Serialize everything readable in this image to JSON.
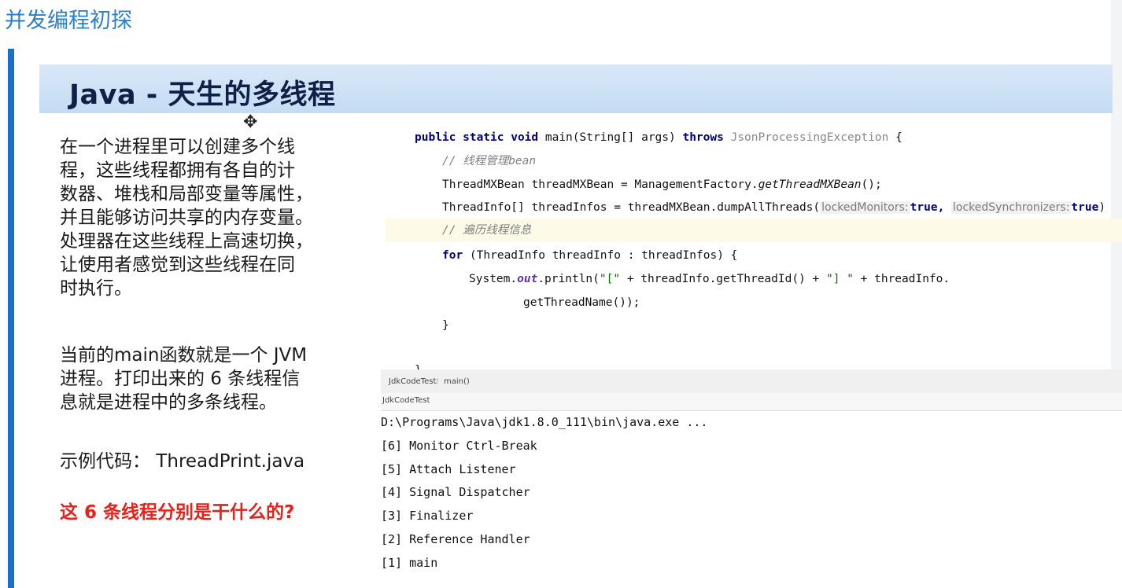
{
  "page": {
    "title": "并发编程初探"
  },
  "slide": {
    "banner_title": "Java - 天生的多线程",
    "paragraph1": "在一个进程里可以创建多个线\n程，这些线程都拥有各自的计\n数器、堆栈和局部变量等属性，\n并且能够访问共享的内存变量。\n处理器在这些线程上高速切换，\n让使用者感觉到这些线程在同\n时执行。",
    "paragraph2": "当前的main函数就是一个 JVM\n进程。打印出来的 6 条线程信\n息就是进程中的多条线程。",
    "paragraph3": "示例代码：  ThreadPrint.java",
    "question": "这 6 条线程分别是干什么的?",
    "question_color": "#e8211b",
    "accent_color": "#1a6fc7"
  },
  "code": {
    "line1": {
      "kw": "public static void",
      "sig": " main(String[] args) ",
      "throws": "throws",
      "exc": " JsonProcessingException",
      "tail": " {"
    },
    "line2": "// 线程管理bean",
    "line3": {
      "a": "ThreadMXBean threadMXBean = ManagementFactory.",
      "b": "getThreadMXBean",
      "c": "();"
    },
    "line4": {
      "a": "ThreadInfo[] threadInfos = threadMXBean.dumpAllThreads(",
      "hint1": "lockedMonitors:",
      "v1": "true",
      "comma": ",",
      "hint2": "lockedSynchronizers:",
      "v2": "true",
      "close": ")"
    },
    "line5": "// 遍历线程信息",
    "line6": {
      "kw": "for",
      "rest": " (ThreadInfo threadInfo : threadInfos) {"
    },
    "line7": {
      "a": "System.",
      "out": "out",
      "b": ".println(",
      "s1": "\"[\"",
      "c": " + threadInfo.getThreadId() + ",
      "s2": "\"] \"",
      "d": " + threadInfo."
    },
    "line8": "getThreadName());",
    "line9": "}",
    "line10": "}"
  },
  "console": {
    "breadcrumb1": "JdkCodeTest",
    "breadcrumb2": "main()",
    "run_tab": "JdkCodeTest",
    "command": "D:\\Programs\\Java\\jdk1.8.0_111\\bin\\java.exe ...",
    "lines": [
      "[6] Monitor Ctrl-Break",
      "[5] Attach Listener",
      "[4] Signal Dispatcher",
      "[3] Finalizer",
      "[2] Reference Handler",
      "[1] main"
    ]
  }
}
